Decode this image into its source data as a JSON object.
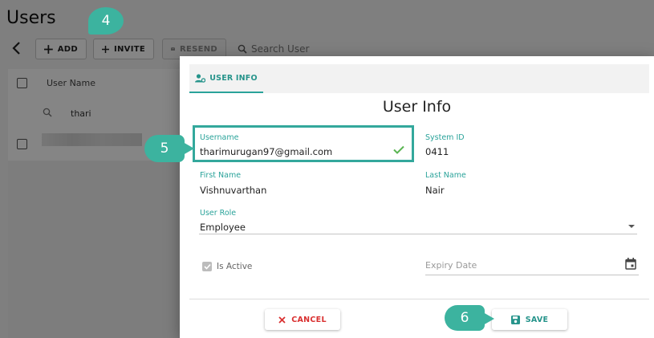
{
  "page": {
    "title": "Users",
    "toolbar": {
      "add_label": "ADD",
      "invite_label": "INVITE",
      "resend_label": "RESEND",
      "search_placeholder": "Search User"
    },
    "table": {
      "column_username": "User Name",
      "filter_value": "thari"
    }
  },
  "dialog": {
    "tab_label": "USER INFO",
    "title": "User Info",
    "fields": {
      "username": {
        "label": "Username",
        "value": "tharimurugan97@gmail.com"
      },
      "system_id": {
        "label": "System ID",
        "value": "0411"
      },
      "first_name": {
        "label": "First Name",
        "value": "Vishnuvarthan"
      },
      "last_name": {
        "label": "Last Name",
        "value": "Nair"
      },
      "user_role": {
        "label": "User Role",
        "value": "Employee"
      },
      "is_active": {
        "label": "Is Active",
        "checked": true
      },
      "expiry_date": {
        "placeholder": "Expiry Date"
      }
    },
    "cancel_label": "CANCEL",
    "save_label": "SAVE"
  },
  "callouts": {
    "step4": "4",
    "step5": "5",
    "step6": "6"
  },
  "colors": {
    "accent": "#2aa39a",
    "callout": "#3cb39f",
    "cancel": "#d93030",
    "valid_check": "#5ab552"
  },
  "icons": [
    "back-arrow-icon",
    "plus-icon",
    "mail-icon",
    "search-icon",
    "user-gear-icon",
    "checkmark-icon",
    "dropdown-arrow-icon",
    "calendar-icon",
    "close-icon",
    "save-icon"
  ]
}
